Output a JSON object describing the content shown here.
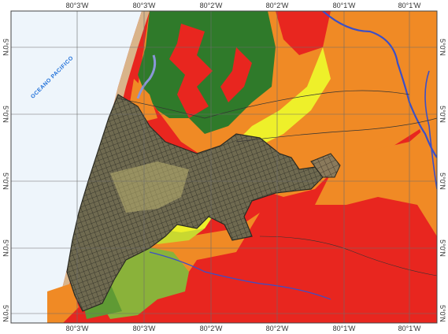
{
  "map": {
    "ocean_label": "OCEANO PACIFICO",
    "top_ticks": [
      "80°3'W",
      "80°3'W",
      "80°2'W",
      "80°2'W",
      "80°1'W",
      "80°1'W"
    ],
    "bottom_ticks": [
      "80°3'W",
      "80°3'W",
      "80°2'W",
      "80°2'W",
      "80°1'W",
      "80°1'W"
    ],
    "left_ticks": [
      "5°0'N",
      "5°0'N",
      "5°0'N",
      "5°0'N",
      "5°0'N"
    ],
    "right_ticks": [
      "5°0'N",
      "5°0'N",
      "5°0'N",
      "5°0'N",
      "5°0'N"
    ],
    "colors": {
      "ocean": "#eef5fb",
      "red": "#e8261f",
      "orange": "#f08a25",
      "dark_green": "#2f7a2a",
      "light_green": "#8ab23a",
      "yellow": "#eef02a",
      "urban": "#7b6a58",
      "river": "#3a4fc9",
      "grid": "#6c6c6c"
    }
  }
}
